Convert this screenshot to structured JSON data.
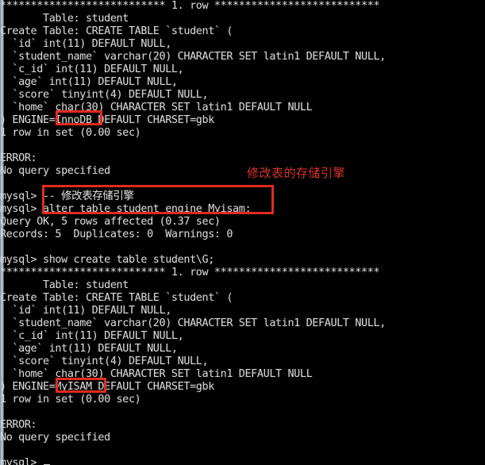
{
  "window": {
    "kind": "mysql-command-line-terminal",
    "background_color": "#000000",
    "text_color": "#d8d8d8",
    "annotation_color": "#d7342b",
    "scrollbar_color": "#b9c8d6"
  },
  "terminal": {
    "lines": [
      "*************************** 1. row ***************************",
      "       Table: student",
      "Create Table: CREATE TABLE `student` (",
      "  `id` int(11) DEFAULT NULL,",
      "  `student_name` varchar(20) CHARACTER SET latin1 DEFAULT NULL,",
      "  `c_id` int(11) DEFAULT NULL,",
      "  `age` int(11) DEFAULT NULL,",
      "  `score` tinyint(4) DEFAULT NULL,",
      "  `home` char(30) CHARACTER SET latin1 DEFAULT NULL",
      ") ENGINE=InnoDB DEFAULT CHARSET=gbk",
      "1 row in set (0.00 sec)",
      "",
      "ERROR:",
      "No query specified",
      "",
      "mysql> -- 修改表存储引擎",
      "mysql> alter table student engine Myisam;",
      "Query OK, 5 rows affected (0.37 sec)",
      "Records: 5  Duplicates: 0  Warnings: 0",
      "",
      "mysql> show create table student\\G;",
      "*************************** 1. row ***************************",
      "       Table: student",
      "Create Table: CREATE TABLE `student` (",
      "  `id` int(11) DEFAULT NULL,",
      "  `student_name` varchar(20) CHARACTER SET latin1 DEFAULT NULL,",
      "  `c_id` int(11) DEFAULT NULL,",
      "  `age` int(11) DEFAULT NULL,",
      "  `score` tinyint(4) DEFAULT NULL,",
      "  `home` char(30) CHARACTER SET latin1 DEFAULT NULL",
      ") ENGINE=MyISAM DEFAULT CHARSET=gbk",
      "1 row in set (0.00 sec)",
      "",
      "ERROR:",
      "No query specified",
      "",
      "mysql> "
    ]
  },
  "annotations": {
    "note_text": "修改表的存储引擎",
    "highlight_innodb": "InnoDB",
    "highlight_myisam": "=MyISAM",
    "highlight_commands": [
      "-- 修改表存储引擎",
      "alter table student engine Myisam;"
    ]
  }
}
